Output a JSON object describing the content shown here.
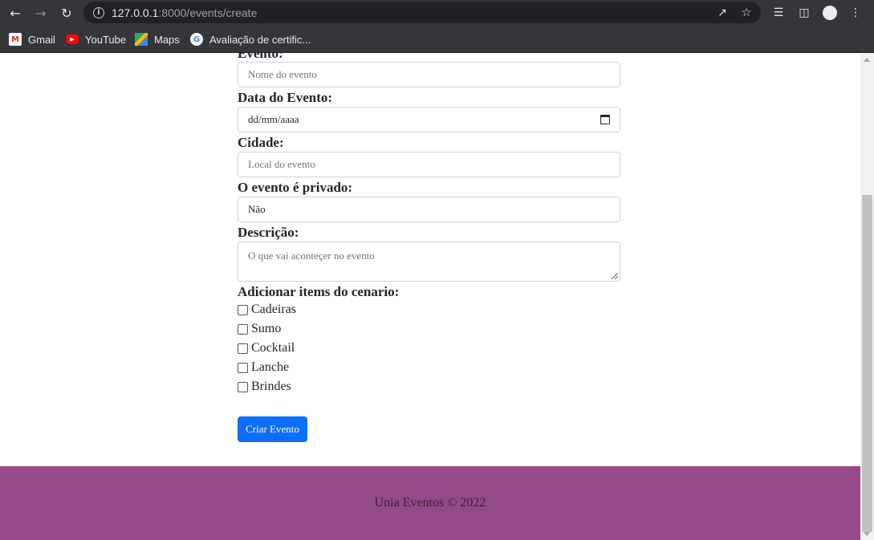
{
  "browser": {
    "url_host": "127.0.0.1",
    "url_path": ":8000/events/create",
    "bookmarks": [
      {
        "label": "Gmail",
        "icon": "gmail-icon"
      },
      {
        "label": "YouTube",
        "icon": "youtube-icon"
      },
      {
        "label": "Maps",
        "icon": "maps-icon"
      },
      {
        "label": "Avaliação de certific...",
        "icon": "google-icon"
      }
    ]
  },
  "form": {
    "event_label": "Evento:",
    "event_placeholder": "Nome do evento",
    "date_label": "Data do Evento:",
    "date_placeholder": "dd/mm/aaaa",
    "city_label": "Cidade:",
    "city_placeholder": "Local do evento",
    "private_label": "O evento é privado:",
    "private_value": "Não",
    "description_label": "Descrição:",
    "description_placeholder": "O que vai aconteçer no evento",
    "items_label": "Adicionar items do cenario:",
    "items": [
      "Cadeiras",
      "Sumo",
      "Cocktail",
      "Lanche",
      "Brindes"
    ],
    "submit_label": "Criar Evento"
  },
  "footer": {
    "text": "Unia Eventos © 2022"
  },
  "colors": {
    "primary": "#0d6efd",
    "footer_bg": "#954a8a",
    "chrome_bg": "#35363a"
  }
}
